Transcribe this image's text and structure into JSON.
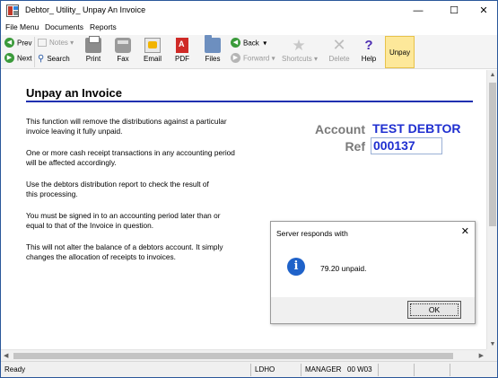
{
  "window": {
    "title": "Debtor_ Utility_ Unpay An Invoice",
    "minimize": "—",
    "maximize": "☐",
    "close": "✕"
  },
  "menu": [
    "File Menu",
    "Documents",
    "Reports"
  ],
  "toolbar": {
    "prev": "Prev",
    "next": "Next",
    "notes": "Notes",
    "search": "Search",
    "print": "Print",
    "fax": "Fax",
    "email": "Email",
    "pdf": "PDF",
    "files": "Files",
    "back": "Back",
    "forward": "Forward",
    "shortcuts": "Shortcuts",
    "delete": "Delete",
    "help": "Help",
    "unpay": "Unpay"
  },
  "page": {
    "title": "Unpay an Invoice",
    "paragraphs": [
      [
        "This function will remove the distributions against a particular",
        "invoice leaving it fully unpaid."
      ],
      [
        "One or more cash receipt transactions in any accounting period",
        "will be affected accordingly."
      ],
      [
        "Use the debtors distribution report to check the result of",
        "this processing."
      ],
      [
        "You must be signed in to an accounting period later than or",
        "equal to that of the Invoice in question."
      ],
      [
        "This will not alter the balance of a debtors account. It simply",
        "changes the allocation of receipts to invoices."
      ]
    ],
    "account_label": "Account",
    "account_value": "TEST DEBTOR",
    "ref_label": "Ref",
    "ref_value": "000137"
  },
  "dialog": {
    "title": "Server responds with",
    "close": "✕",
    "icon": "i",
    "message": "79.20 unpaid.",
    "ok": "OK"
  },
  "status": {
    "state": "Ready",
    "location": "LDHO",
    "user": "MANAGER",
    "code": "00 W03"
  },
  "colors": {
    "accent_blue": "#1f2fd0",
    "title_rule": "#2030b0",
    "unpay_highlight": "#fde89a",
    "info_icon": "#1f62c9"
  }
}
